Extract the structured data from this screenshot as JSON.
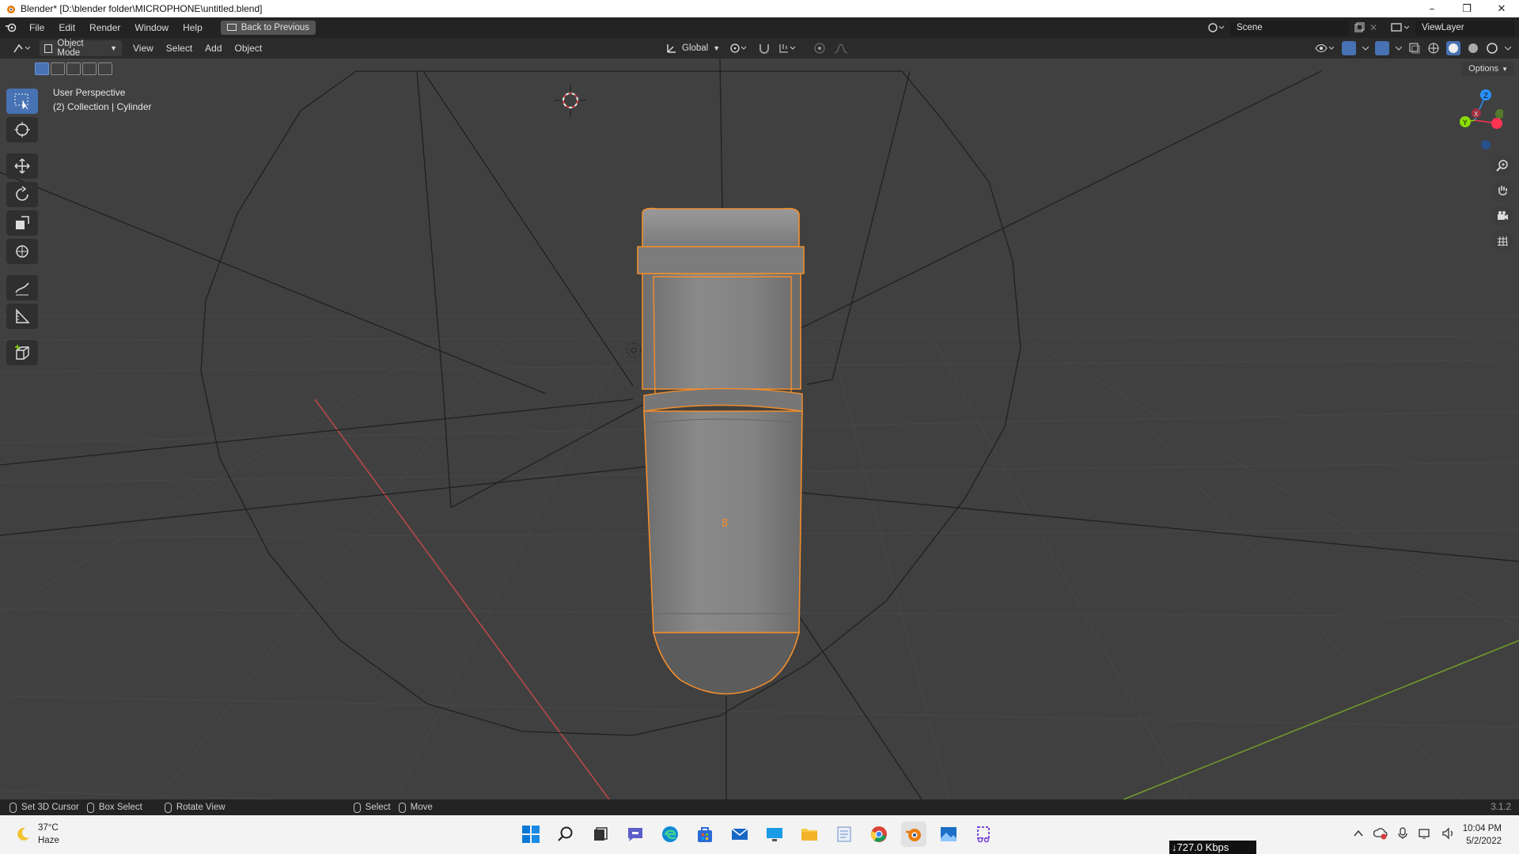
{
  "window": {
    "title": "Blender* [D:\\blender folder\\MICROPHONE\\untitled.blend]",
    "minimize_icon": "minimize-icon",
    "maximize_icon": "restore-icon",
    "close_icon": "close-icon"
  },
  "topbar": {
    "menus": [
      "File",
      "Edit",
      "Render",
      "Window",
      "Help"
    ],
    "back_label": "Back to Previous",
    "scene_label": "Scene",
    "viewlayer_label": "ViewLayer"
  },
  "header": {
    "mode_label": "Object Mode",
    "menus": [
      "View",
      "Select",
      "Add",
      "Object"
    ],
    "transform_orientation": "Global"
  },
  "toolheader": {
    "options_label": "Options"
  },
  "viewport": {
    "perspective_label": "User Perspective",
    "collection_label": "(2) Collection | Cylinder",
    "origin_marker": "8"
  },
  "gizmo": {
    "x_label": "X",
    "y_label": "Y",
    "z_label": "Z",
    "colors": {
      "x": "#ff3352",
      "y": "#8bdc00",
      "z": "#2890ff"
    }
  },
  "statusbar": {
    "set_cursor": "Set 3D Cursor",
    "box_select": "Box Select",
    "rotate_view": "Rotate View",
    "select": "Select",
    "move": "Move",
    "version": "3.1.2"
  },
  "taskbar": {
    "temperature": "37°C",
    "weather": "Haze",
    "network_speed": "↓727.0 Kbps",
    "time": "10:04 PM",
    "date": "5/2/2022"
  },
  "colors": {
    "selection_outline": "#f28d2c",
    "active_tool": "#4772b3",
    "x_axis": "#c84545",
    "y_axis": "#6f9a2c"
  }
}
